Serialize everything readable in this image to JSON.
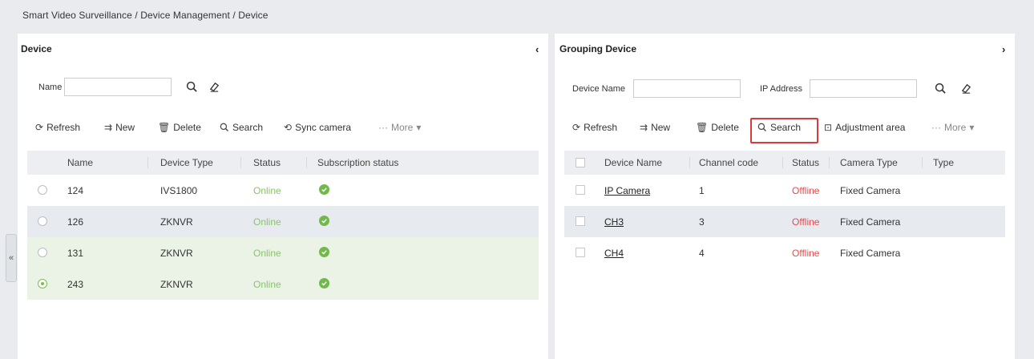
{
  "breadcrumb": "Smart Video Surveillance / Device Management / Device",
  "left_handle_glyph": "«",
  "left_panel": {
    "title": "Device",
    "collapse_glyph": "‹",
    "filter": {
      "name_label": "Name",
      "name_value": "",
      "name_placeholder": ""
    },
    "toolbar": {
      "refresh": "Refresh",
      "new": "New",
      "delete": "Delete",
      "search": "Search",
      "sync": "Sync camera",
      "more": "More"
    },
    "columns": [
      "Name",
      "Device Type",
      "Status",
      "Subscription status"
    ],
    "rows": [
      {
        "name": "124",
        "type": "IVS1800",
        "status": "Online",
        "selected": false
      },
      {
        "name": "126",
        "type": "ZKNVR",
        "status": "Online",
        "selected": false
      },
      {
        "name": "131",
        "type": "ZKNVR",
        "status": "Online",
        "selected": false
      },
      {
        "name": "243",
        "type": "ZKNVR",
        "status": "Online",
        "selected": true
      }
    ]
  },
  "right_panel": {
    "title": "Grouping Device",
    "collapse_glyph": "›",
    "filter": {
      "device_name_label": "Device Name",
      "device_name_value": "",
      "ip_label": "IP Address",
      "ip_value": ""
    },
    "toolbar": {
      "refresh": "Refresh",
      "new": "New",
      "delete": "Delete",
      "search": "Search",
      "adjust": "Adjustment area",
      "more": "More"
    },
    "columns": [
      "Device Name",
      "Channel code",
      "Status",
      "Camera Type",
      "Type"
    ],
    "rows": [
      {
        "device_name": "IP Camera",
        "channel": "1",
        "status": "Offline",
        "camera_type": "Fixed Camera",
        "type": ""
      },
      {
        "device_name": "CH3",
        "channel": "3",
        "status": "Offline",
        "camera_type": "Fixed Camera",
        "type": ""
      },
      {
        "device_name": "CH4",
        "channel": "4",
        "status": "Offline",
        "camera_type": "Fixed Camera",
        "type": ""
      }
    ]
  },
  "colors": {
    "online": "#8ac46b",
    "offline": "#e24b4b",
    "highlight": "#d93b3b",
    "selected_row": "#eaf3e5",
    "alt_row": "#e7ebf0"
  }
}
